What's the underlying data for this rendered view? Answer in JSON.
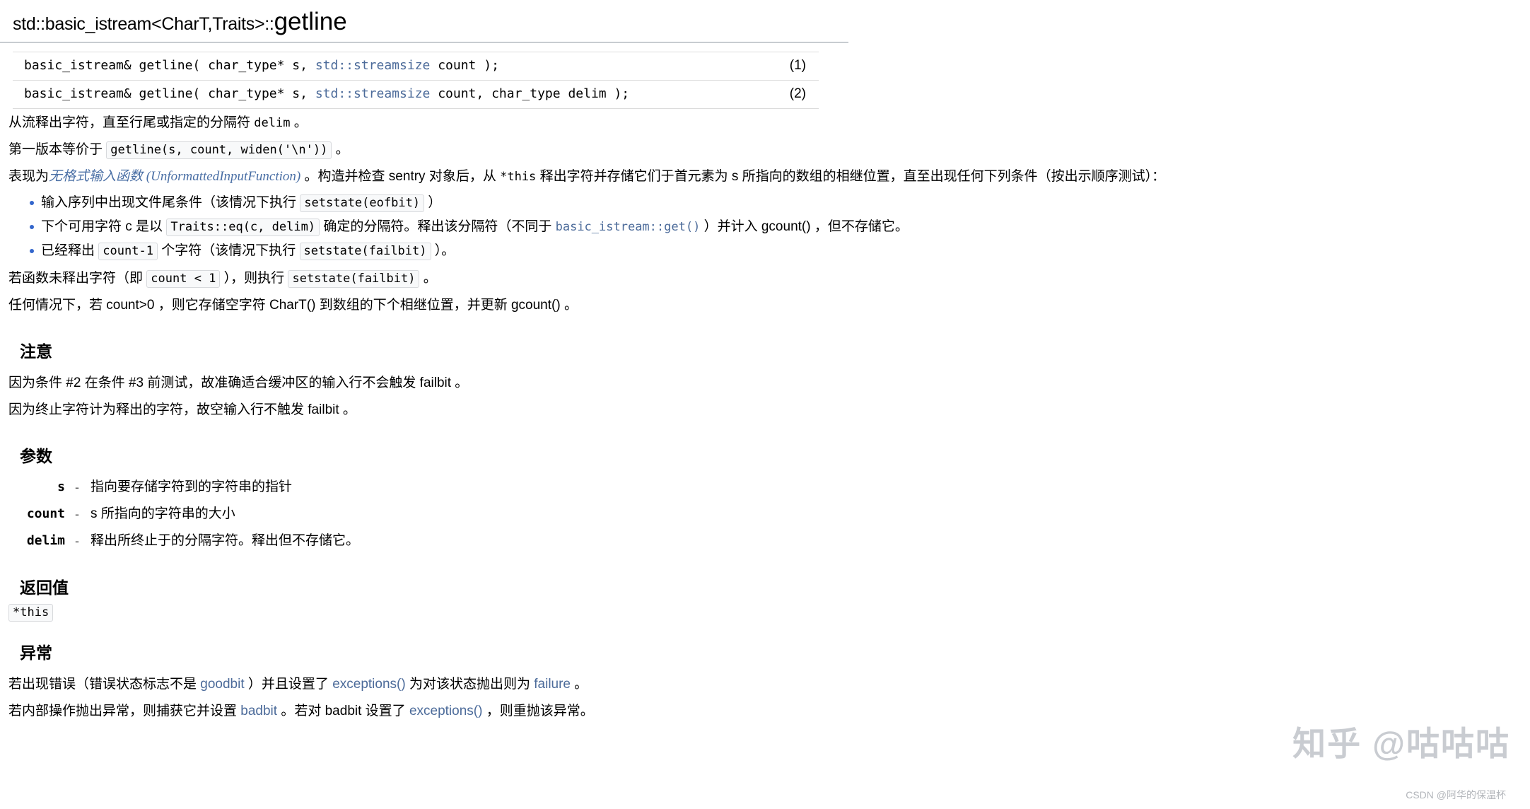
{
  "page": {
    "title_qualifier": "std::basic_istream<CharT,Traits>::",
    "title_name": "getline"
  },
  "signatures": {
    "rows": [
      {
        "pre": "basic_istream& getline( char_type* s, ",
        "link": "std::streamsize",
        "post": " count );",
        "number": "(1)"
      },
      {
        "pre": "basic_istream& getline( char_type* s, ",
        "link": "std::streamsize",
        "post": " count, char_type delim );",
        "number": "(2)"
      }
    ]
  },
  "description": {
    "line1": "从流释出字符，直至行尾或指定的分隔符 ",
    "line1_code": "delim",
    "line1_end": " 。",
    "line2_pre": "第一版本等价于 ",
    "line2_code": "getline(s, count, widen('\\n'))",
    "line2_end": " 。",
    "line3_pre": "表现为",
    "line3_link_cn": "无格式输入函数",
    "line3_link_en": " (UnformattedInputFunction)",
    "line3_mid": " 。构造并检查 sentry 对象后，从 ",
    "line3_code": "*this",
    "line3_post": " 释出字符并存储它们于首元素为 s 所指向的数组的相继位置，直至出现任何下列条件（按出示顺序测试）：",
    "conditions": [
      {
        "pre": "输入序列中出现文件尾条件（该情况下执行 ",
        "code": "setstate(eofbit)",
        "post": " ）"
      },
      {
        "pre": "下个可用字符 c 是以 ",
        "code": "Traits::eq(c, delim)",
        "mid": " 确定的分隔符。释出该分隔符（不同于 ",
        "link": "basic_istream::get()",
        "post": " ）并计入 gcount() ，但不存储它。"
      },
      {
        "pre": "已经释出 ",
        "code": "count-1",
        "mid": " 个字符（该情况下执行 ",
        "code2": "setstate(failbit)",
        "post": " ）。"
      }
    ],
    "line4_pre": "若函数未释出字符（即 ",
    "line4_code": "count < 1",
    "line4_mid": " ），则执行 ",
    "line4_code2": "setstate(failbit)",
    "line4_end": " 。",
    "line5": "任何情况下，若 count>0 ，则它存储空字符 CharT() 到数组的下个相继位置，并更新 gcount() 。"
  },
  "notes": {
    "heading": "注意",
    "line1": "因为条件 #2 在条件 #3 前测试，故准确适合缓冲区的输入行不会触发 failbit 。",
    "line2": "因为终止字符计为释出的字符，故空输入行不触发 failbit 。"
  },
  "parameters": {
    "heading": "参数",
    "rows": [
      {
        "name": "s",
        "dash": "-",
        "desc": "指向要存储字符到的字符串的指针"
      },
      {
        "name": "count",
        "dash": "-",
        "desc": "s 所指向的字符串的大小"
      },
      {
        "name": "delim",
        "dash": "-",
        "desc": "释出所终止于的分隔字符。释出但不存储它。"
      }
    ]
  },
  "return_value": {
    "heading": "返回值",
    "value": "*this"
  },
  "exceptions": {
    "heading": "异常",
    "line1_a": "若出现错误（错误状态标志不是 ",
    "line1_link1": "goodbit",
    "line1_b": " ）并且设置了 ",
    "line1_link2": "exceptions()",
    "line1_c": " 为对该状态抛出则为 ",
    "line1_link3": "failure",
    "line1_d": " 。",
    "line2_a": "若内部操作抛出异常，则捕获它并设置 ",
    "line2_link1": "badbit",
    "line2_b": " 。若对 badbit 设置了 ",
    "line2_link2": "exceptions()",
    "line2_c": " ，则重抛该异常。"
  },
  "watermark": {
    "text": "知乎 @咕咕咕",
    "credit": "CSDN @阿华的保温杯"
  },
  "colors": {
    "link": "#4c6b9a",
    "bullet": "#3366cc",
    "code_bg": "#f8f9fa",
    "rule": "#c8ccd1"
  }
}
